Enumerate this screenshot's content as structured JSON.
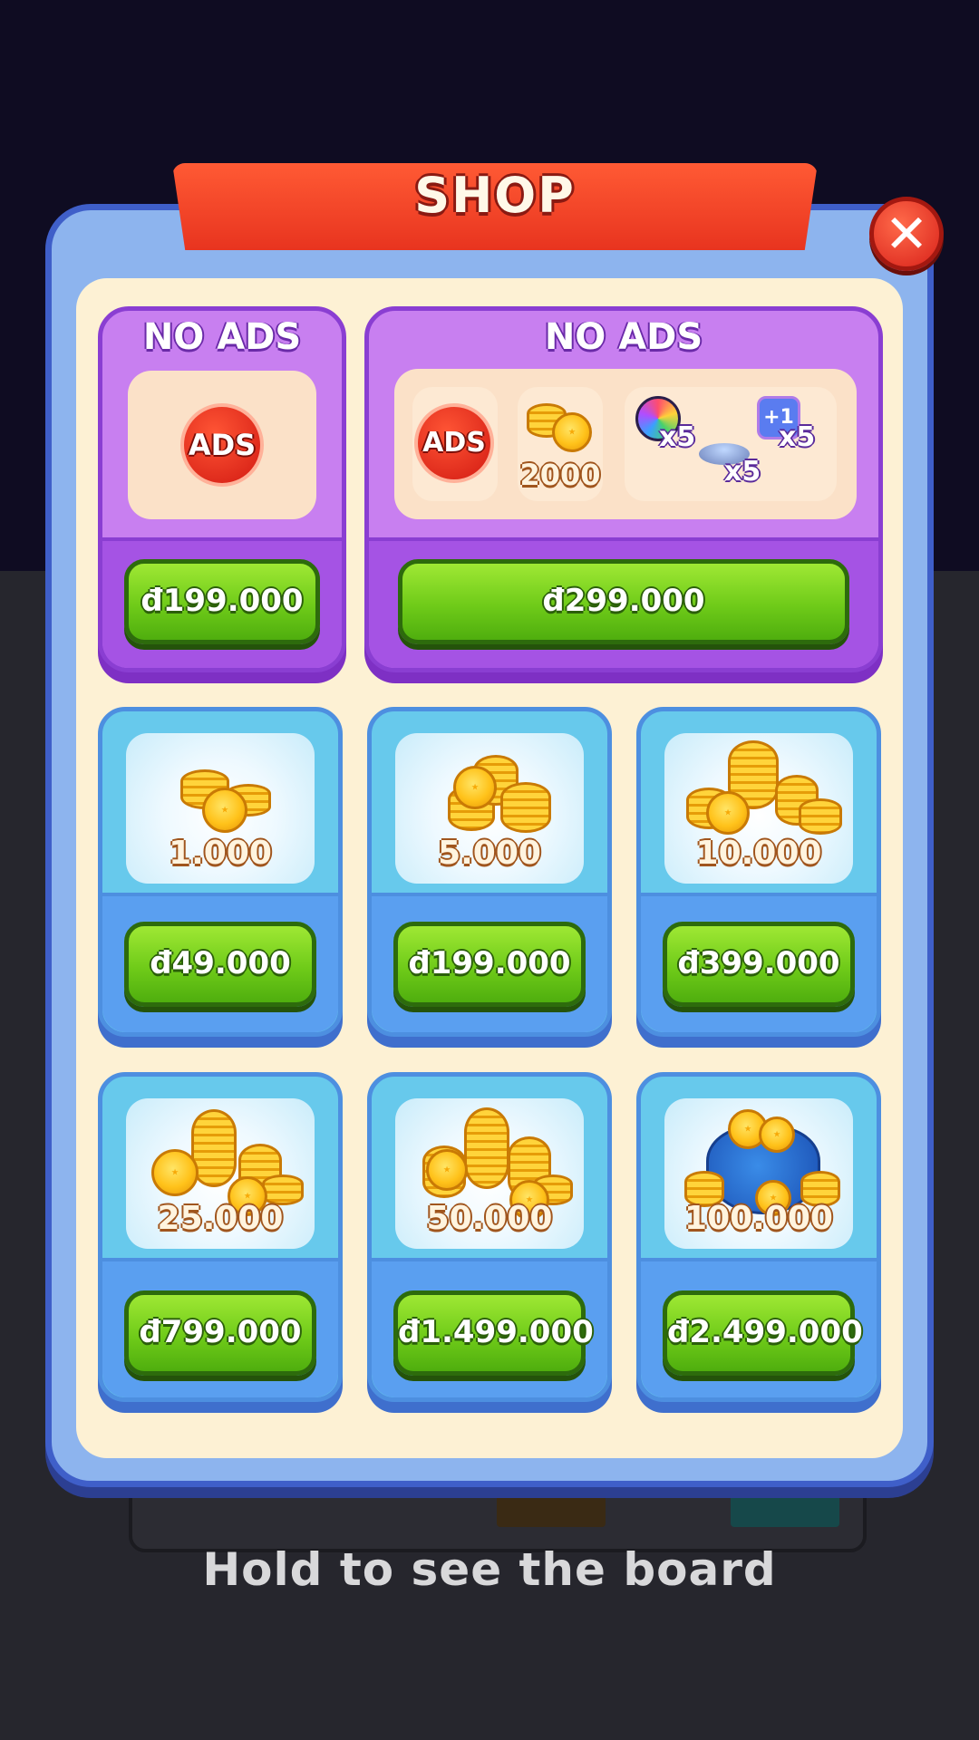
{
  "shop": {
    "title": "SHOP",
    "close_icon": "close-icon"
  },
  "no_ads_single": {
    "title": "NO ADS",
    "badge": "ADS",
    "price": "đ199.000"
  },
  "no_ads_bundle": {
    "title": "NO ADS",
    "badge": "ADS",
    "coins": "2000",
    "items": [
      {
        "icon": "magnet-wrench-icon",
        "qty": "x5"
      },
      {
        "icon": "plus-one-icon",
        "qty": "x5"
      },
      {
        "icon": "ufo-icon",
        "qty": "x5"
      }
    ],
    "price": "đ299.000"
  },
  "coin_packs": [
    {
      "amount": "1.000",
      "price": "đ49.000"
    },
    {
      "amount": "5.000",
      "price": "đ199.000"
    },
    {
      "amount": "10.000",
      "price": "đ399.000"
    },
    {
      "amount": "25.000",
      "price": "đ799.000"
    },
    {
      "amount": "50.000",
      "price": "đ1.499.000"
    },
    {
      "amount": "100.000",
      "price": "đ2.499.000"
    }
  ],
  "footer": {
    "hint": "Hold to see the board"
  },
  "colors": {
    "ribbon": "#e8341f",
    "panel_border": "#3f5fc9",
    "buy_button": "#6fcb19",
    "purple_card": "#c87ff0",
    "blue_card": "#67c9ec"
  }
}
